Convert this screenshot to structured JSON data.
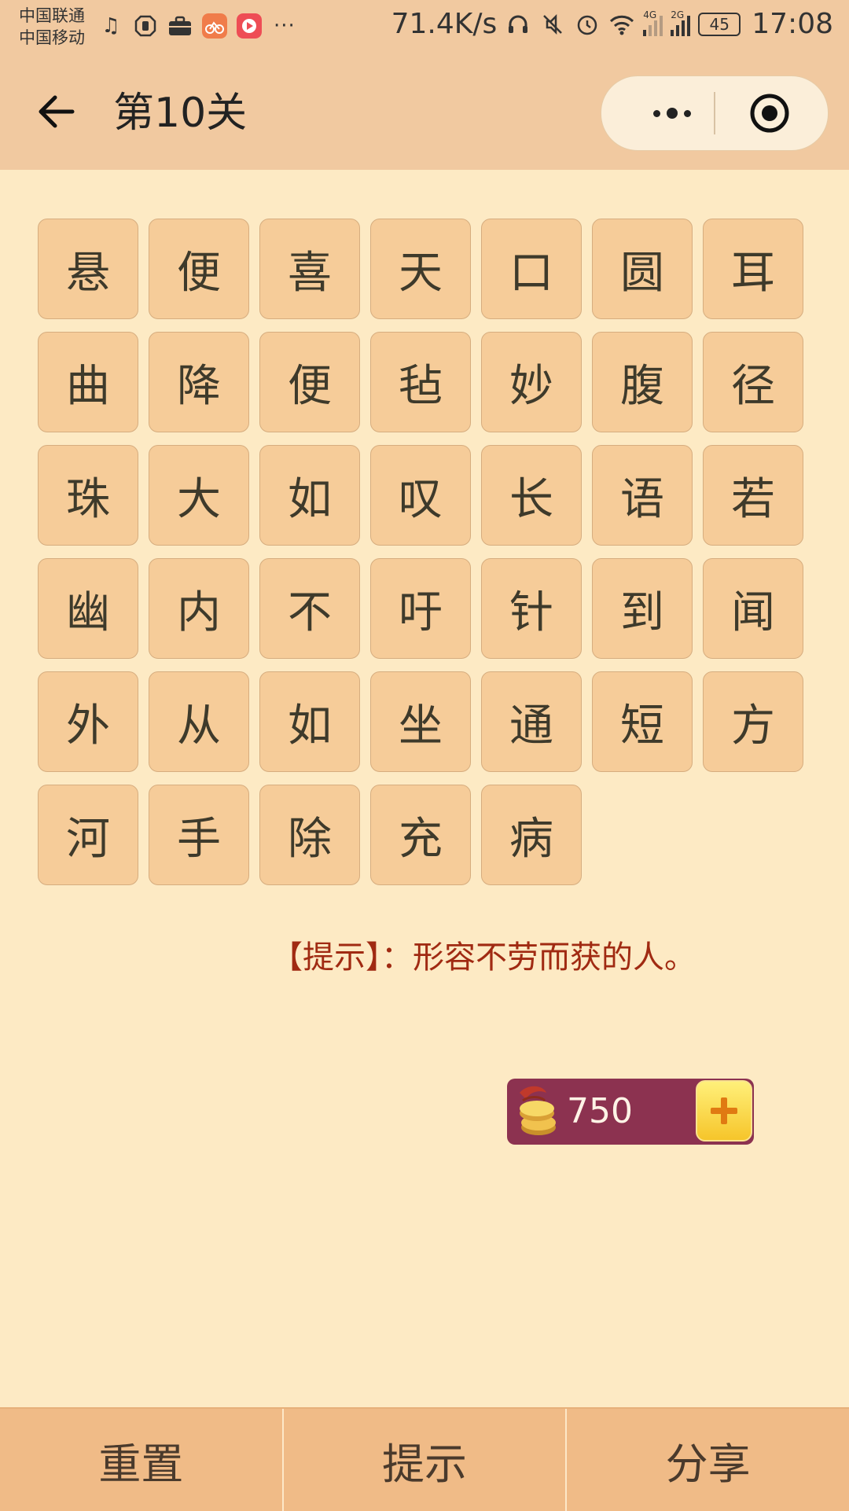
{
  "status_bar": {
    "carrier1": "中国联通",
    "carrier2": "中国移动",
    "speed": "71.4K/s",
    "net1": "4G",
    "net2": "2G",
    "battery": "45",
    "time": "17:08",
    "icons": [
      "music-icon",
      "hand-icon",
      "briefcase-icon",
      "bike-app-icon",
      "video-app-icon",
      "more-dots",
      "headphones-icon",
      "mute-icon",
      "alarm-icon",
      "wifi-icon",
      "signal-icon",
      "battery-icon"
    ]
  },
  "nav": {
    "title": "第10关",
    "icons": [
      "back-arrow-icon",
      "more-icon",
      "close-target-icon"
    ]
  },
  "grid": {
    "chars": [
      "悬",
      "便",
      "喜",
      "天",
      "口",
      "圆",
      "耳",
      "曲",
      "降",
      "便",
      "毡",
      "妙",
      "腹",
      "径",
      "珠",
      "大",
      "如",
      "叹",
      "长",
      "语",
      "若",
      "幽",
      "内",
      "不",
      "吁",
      "针",
      "到",
      "闻",
      "外",
      "从",
      "如",
      "坐",
      "通",
      "短",
      "方",
      "河",
      "手",
      "除",
      "充",
      "病"
    ]
  },
  "hint": {
    "label": "【提示】：",
    "text": "形容不劳而获的人。"
  },
  "coins": {
    "count": "750",
    "add_symbol": "+"
  },
  "bottom": {
    "reset": "重置",
    "hint": "提示",
    "share": "分享"
  },
  "colors": {
    "background": "#fdeac4",
    "header": "#f1c9a0",
    "tile": "#f6cc99",
    "hint_text": "#a02a12",
    "coin_bar": "#8c3250",
    "bottom_bar": "#f0bb87"
  }
}
